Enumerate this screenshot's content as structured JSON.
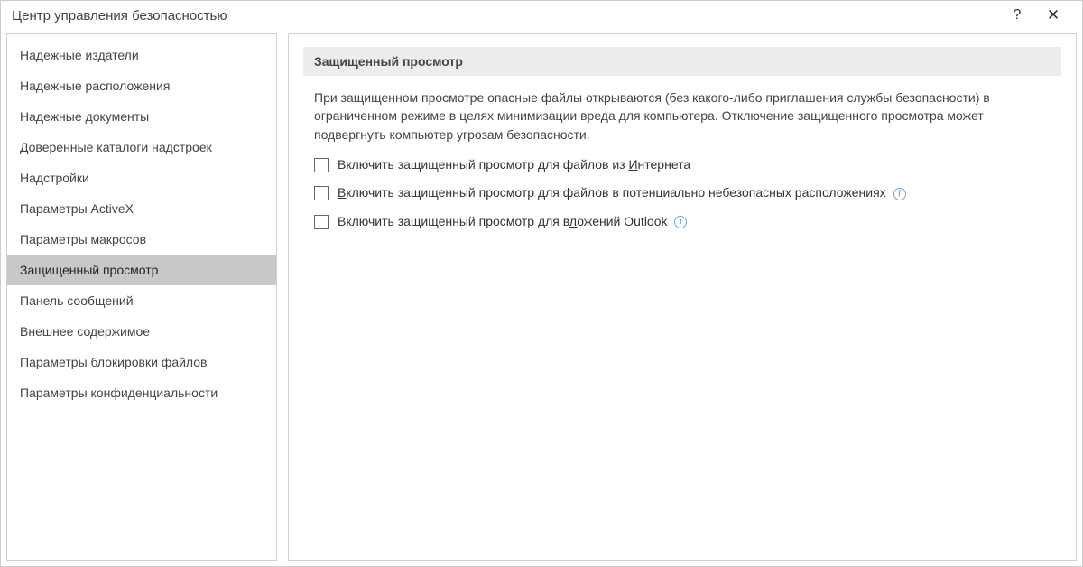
{
  "window": {
    "title": "Центр управления безопасностью",
    "help": "?",
    "close": "✕"
  },
  "sidebar": {
    "items": [
      {
        "label": "Надежные издатели",
        "selected": false
      },
      {
        "label": "Надежные расположения",
        "selected": false
      },
      {
        "label": "Надежные документы",
        "selected": false
      },
      {
        "label": "Доверенные каталоги надстроек",
        "selected": false
      },
      {
        "label": "Надстройки",
        "selected": false
      },
      {
        "label": "Параметры ActiveX",
        "selected": false
      },
      {
        "label": "Параметры макросов",
        "selected": false
      },
      {
        "label": "Защищенный просмотр",
        "selected": true
      },
      {
        "label": "Панель сообщений",
        "selected": false
      },
      {
        "label": "Внешнее содержимое",
        "selected": false
      },
      {
        "label": "Параметры блокировки файлов",
        "selected": false
      },
      {
        "label": "Параметры конфиденциальности",
        "selected": false
      }
    ]
  },
  "main": {
    "section_title": "Защищенный просмотр",
    "description": "При защищенном просмотре опасные файлы открываются (без какого-либо приглашения службы безопасности) в ограниченном режиме в целях минимизации вреда для компьютера. Отключение защищенного просмотра может подвергнуть компьютер угрозам безопасности.",
    "options": [
      {
        "checked": false,
        "prefix": "Включить защищенный просмотр для файлов из ",
        "accel": "И",
        "suffix": "нтернета",
        "info": false
      },
      {
        "checked": false,
        "prefix": "",
        "accel": "В",
        "suffix": "ключить защищенный просмотр для файлов в потенциально небезопасных расположениях",
        "info": true
      },
      {
        "checked": false,
        "prefix": "Включить защищенный просмотр для в",
        "accel": "л",
        "suffix": "ожений Outlook",
        "info": true
      }
    ]
  },
  "info_glyph": "i"
}
